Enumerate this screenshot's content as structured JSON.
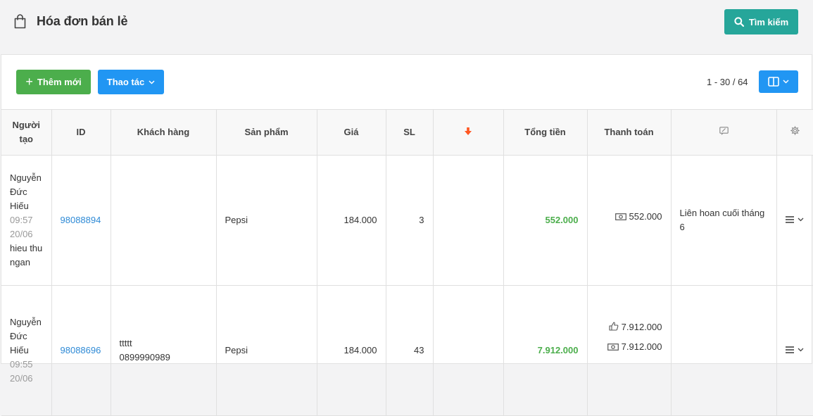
{
  "header": {
    "title": "Hóa đơn bán lẻ",
    "search_label": "Tìm kiếm"
  },
  "toolbar": {
    "add_label": "Thêm mới",
    "actions_label": "Thao tác",
    "pagination": "1 - 30 / 64"
  },
  "table": {
    "columns": [
      "Người tạo",
      "ID",
      "Khách hàng",
      "Sản phẩm",
      "Giá",
      "SL",
      "Tổng tiền",
      "Thanh toán"
    ],
    "rows": [
      {
        "creator_name": "Nguyễn Đức Hiếu",
        "time": "09:57",
        "date": "20/06",
        "cashier": "hieu thu ngan",
        "id": "98088894",
        "customer_name": "",
        "customer_phone": "",
        "product": "Pepsi",
        "price": "184.000",
        "qty": "3",
        "total": "552.000",
        "payment_cash": "552.000",
        "payment_card": "",
        "note": "Liên hoan cuối tháng 6"
      },
      {
        "creator_name": "Nguyễn Đức Hiếu",
        "time": "09:55",
        "date": "20/06",
        "cashier": "",
        "id": "98088696",
        "customer_name": "ttttt",
        "customer_phone": "0899990989",
        "product": "Pepsi",
        "price": "184.000",
        "qty": "43",
        "total": "7.912.000",
        "payment_card": "7.912.000",
        "payment_cash": "7.912.000",
        "note": ""
      }
    ]
  },
  "colors": {
    "primary": "#2196f3",
    "success": "#4cae4c",
    "teal": "#26a69a",
    "link": "#2e8ad6",
    "sort_arrow": "#ff5722"
  },
  "icons": [
    "shopping-bag-icon",
    "search-icon",
    "plus-icon",
    "chevron-down-icon",
    "columns-icon",
    "arrow-down-icon",
    "note-icon",
    "gear-icon",
    "cash-icon",
    "thumbs-up-icon",
    "hamburger-menu-icon"
  ]
}
